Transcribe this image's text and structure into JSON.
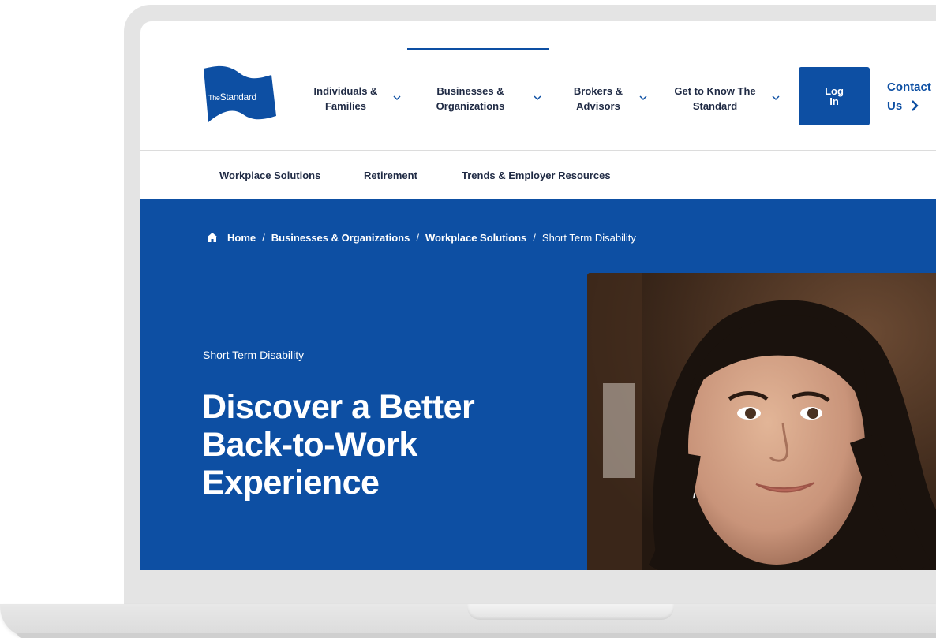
{
  "brand": {
    "logo_text_prefix": "The",
    "logo_text_main": "Standard",
    "primary_color": "#0d4fa3",
    "text_color": "#1f2a44"
  },
  "nav": {
    "items": [
      {
        "label": "Individuals &\nFamilies"
      },
      {
        "label": "Businesses &\nOrganizations"
      },
      {
        "label": "Brokers &\nAdvisors"
      },
      {
        "label": "Get to Know The\nStandard"
      }
    ],
    "login_label": "Log\nIn",
    "contact_label": "Contact\nUs"
  },
  "subnav": {
    "items": [
      "Workplace Solutions",
      "Retirement",
      "Trends & Employer Resources"
    ]
  },
  "breadcrumb": {
    "items": [
      "Home",
      "Businesses & Organizations",
      "Workplace Solutions"
    ],
    "current": "Short Term Disability",
    "separator": "/"
  },
  "hero": {
    "eyebrow": "Short Term Disability",
    "headline": "Discover a Better Back-to-Work Experience",
    "image_icon": "woman-portrait-photo"
  }
}
